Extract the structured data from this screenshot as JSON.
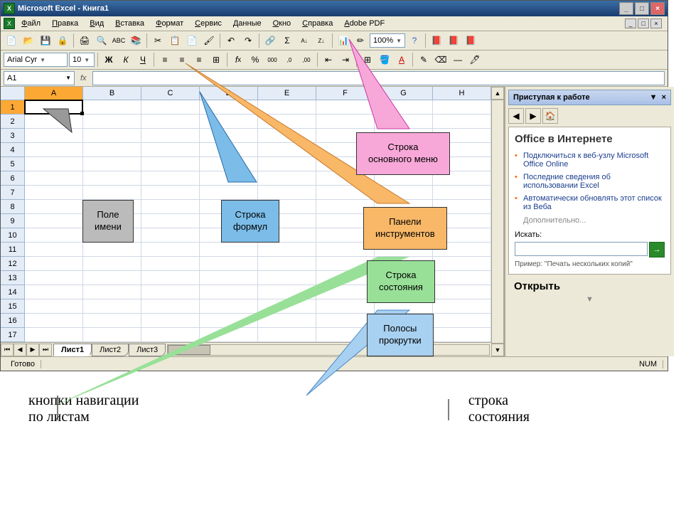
{
  "title": "Microsoft Excel - Книга1",
  "menu": [
    "Файл",
    "Правка",
    "Вид",
    "Вставка",
    "Формат",
    "Сервис",
    "Данные",
    "Окно",
    "Справка",
    "Adobe PDF"
  ],
  "font": {
    "name": "Arial Cyr",
    "size": "10"
  },
  "zoom": "100%",
  "nameBox": "A1",
  "fxLabel": "fx",
  "columns": [
    "A",
    "B",
    "C",
    "D",
    "E",
    "F",
    "G",
    "H"
  ],
  "rowCount": 17,
  "tabs": [
    "Лист1",
    "Лист2",
    "Лист3"
  ],
  "activeTab": 0,
  "statusReady": "Готово",
  "statusNum": "NUM",
  "taskPane": {
    "title": "Приступая к работе",
    "section1": "Office в Интернете",
    "links": [
      "Подключиться к веб-узлу Microsoft Office Online",
      "Последние сведения об использовании Excel",
      "Автоматически обновлять этот список из Веба"
    ],
    "more": "Дополнительно...",
    "searchLabel": "Искать:",
    "example": "Пример:  \"Печать нескольких копий\"",
    "open": "Открыть"
  },
  "callouts": {
    "nameField": "Поле\nимени",
    "formulaBar": "Строка\nформул",
    "mainMenu": "Строка\nосновного меню",
    "toolbars": "Панели\nинструментов",
    "statusBar": "Строка\nсостояния",
    "scrollBars": "Полосы\nпрокрутки"
  },
  "bottomLabels": {
    "navButtons": "кнопки навигации\nпо листам",
    "statusBar": "строка\nсостояния"
  }
}
